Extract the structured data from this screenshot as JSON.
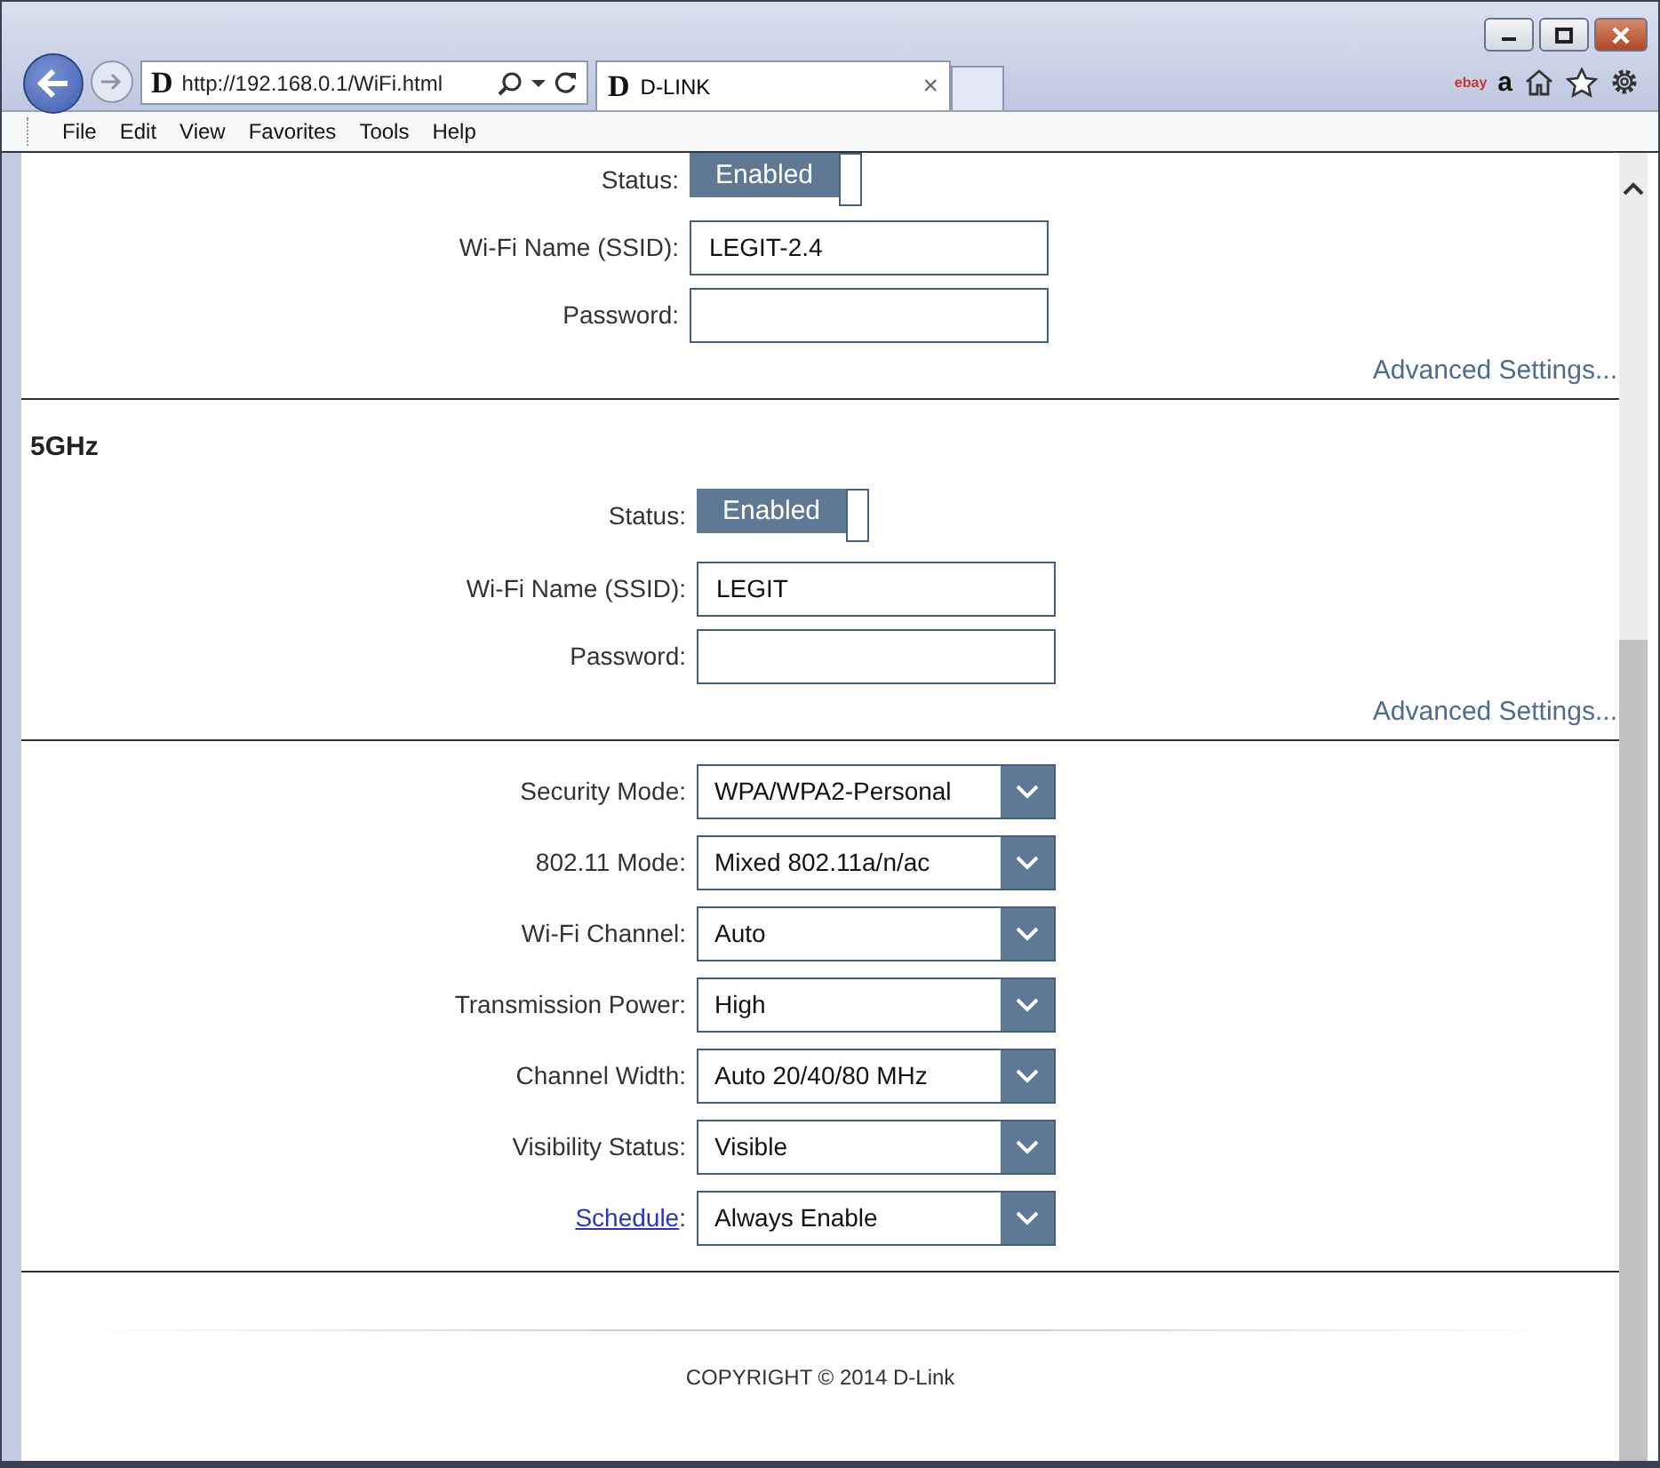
{
  "browser": {
    "site_icon": "D",
    "address": "http://192.168.0.1/WiFi.html",
    "tab": {
      "icon": "D",
      "title": "D-LINK",
      "close": "×"
    },
    "favorites": [
      {
        "label": "ebay"
      },
      {
        "label": "a"
      }
    ],
    "menu": [
      "File",
      "Edit",
      "View",
      "Favorites",
      "Tools",
      "Help"
    ]
  },
  "bands": [
    {
      "status_label": "Status:",
      "status": {
        "text": "Enabled",
        "on": true
      },
      "ssid_label": "Wi-Fi Name (SSID):",
      "ssid": "LEGIT-2.4",
      "password_label": "Password:",
      "advanced": "Advanced Settings..."
    },
    {
      "heading": "5GHz",
      "status_label": "Status:",
      "status": {
        "text": "Enabled",
        "on": true
      },
      "ssid_label": "Wi-Fi Name (SSID):",
      "ssid": "LEGIT",
      "password_label": "Password:",
      "advanced": "Advanced Settings..."
    }
  ],
  "settings": [
    {
      "kind": "plain",
      "label": "Security Mode:",
      "value": "WPA/WPA2-Personal"
    },
    {
      "kind": "plain",
      "label": "802.11 Mode:",
      "value": "Mixed 802.11a/n/ac"
    },
    {
      "kind": "plain",
      "label": "Wi-Fi Channel:",
      "value": "Auto"
    },
    {
      "kind": "plain",
      "label": "Transmission Power:",
      "value": "High"
    },
    {
      "kind": "plain",
      "label": "Channel Width:",
      "value": "Auto 20/40/80 MHz"
    },
    {
      "kind": "plain",
      "label": "Visibility Status:",
      "value": "Visible"
    },
    {
      "kind": "link",
      "label": "Schedule",
      "suffix": ":",
      "value": "Always Enable"
    }
  ],
  "footer": "COPYRIGHT © 2014 D-Link"
}
